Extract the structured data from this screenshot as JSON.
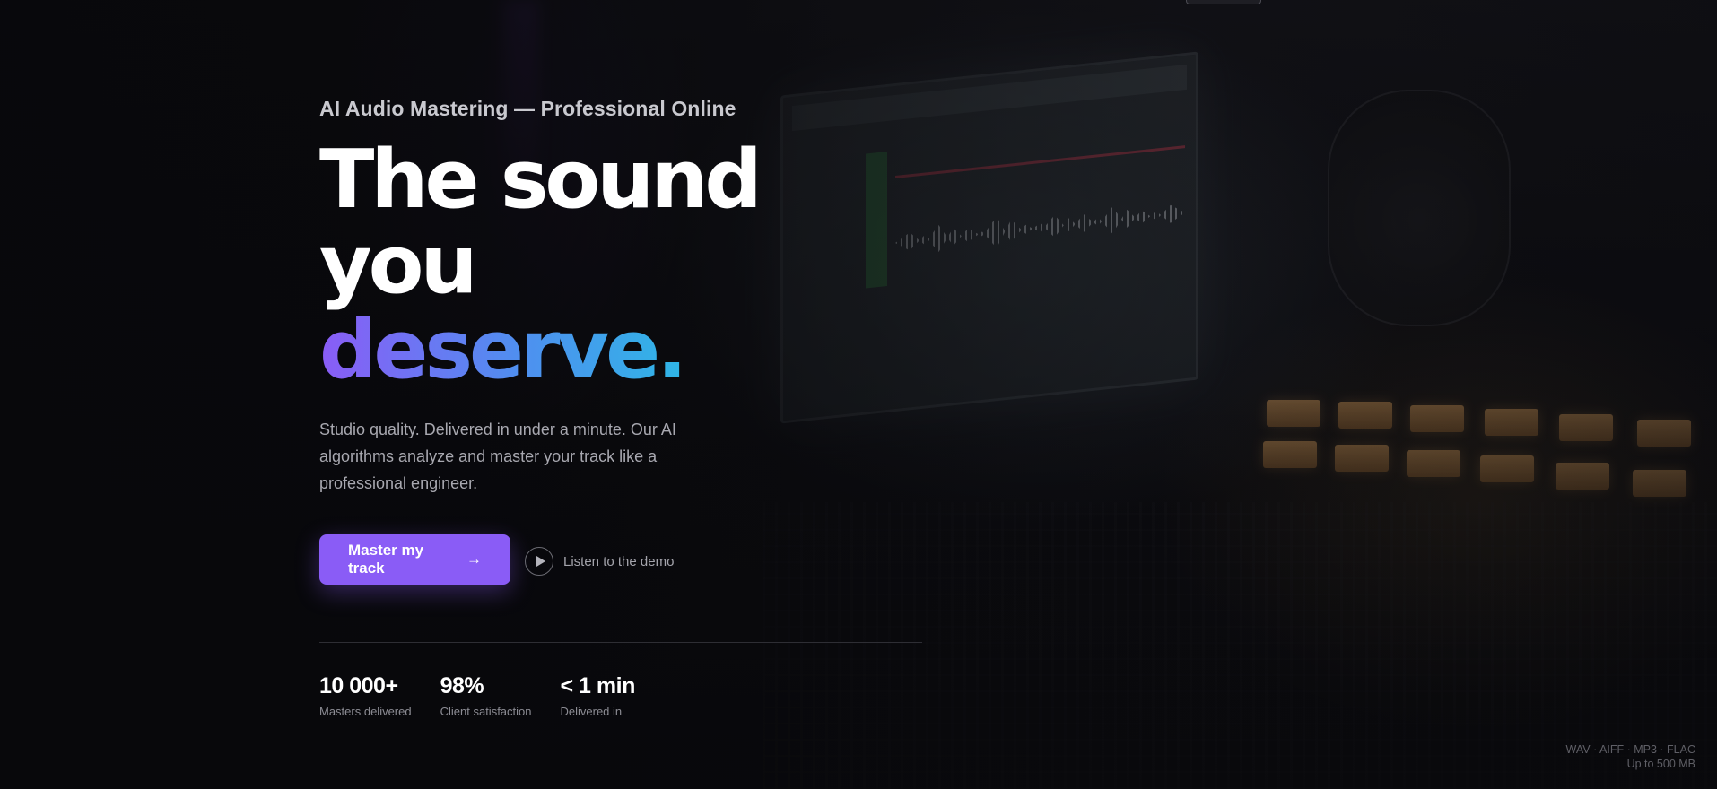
{
  "hero": {
    "eyebrow": "AI Audio Mastering — Professional Online",
    "headline": {
      "line1": "The sound",
      "line2": "you",
      "accent": "deserve."
    },
    "subtitle": "Studio quality. Delivered in under a minute. Our AI algorithms analyze and master your track like a professional engineer.",
    "cta": {
      "label": "Master my track",
      "icon": "arrow-right-icon",
      "color": "#8a5cf6"
    },
    "demo": {
      "label": "Listen to the demo",
      "icon": "play-icon"
    }
  },
  "stats": [
    {
      "value": "10 000+",
      "label": "Masters delivered"
    },
    {
      "value": "98%",
      "label": "Client satisfaction"
    },
    {
      "value": "< 1 min",
      "label": "Delivered in"
    }
  ],
  "formats": {
    "line1": "WAV · AIFF · MP3 · FLAC",
    "line2": "Up to 500 MB"
  },
  "colors": {
    "accent_start": "#8a5cf6",
    "accent_end": "#2fb6e6",
    "background": "#0b0b0f"
  }
}
